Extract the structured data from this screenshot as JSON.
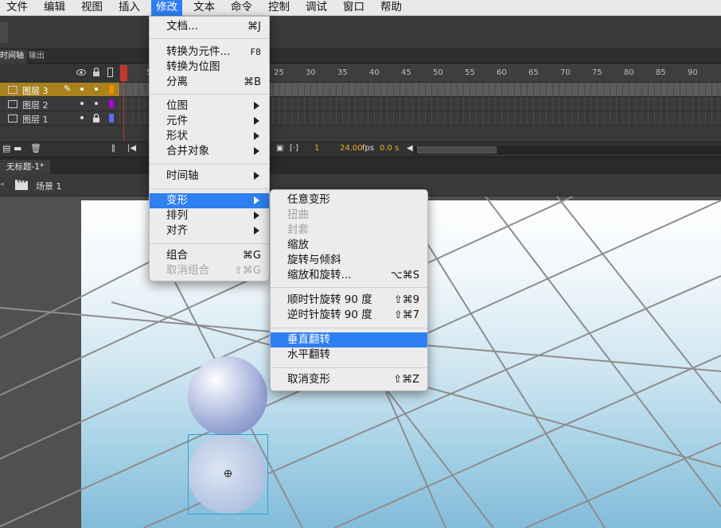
{
  "menubar": [
    "文件",
    "编辑",
    "视图",
    "插入",
    "修改",
    "文本",
    "命令",
    "控制",
    "调试",
    "窗口",
    "帮助"
  ],
  "modify_menu": {
    "items": [
      {
        "label": "文档...",
        "shortcut": "⌘J"
      },
      {
        "label": "转换为元件...",
        "shortcut": "F8"
      },
      {
        "label": "转换为位图",
        "shortcut": ""
      },
      {
        "label": "分离",
        "shortcut": "⌘B"
      },
      {
        "label": "位图",
        "submenu": true
      },
      {
        "label": "元件",
        "submenu": true
      },
      {
        "label": "形状",
        "submenu": true
      },
      {
        "label": "合并对象",
        "submenu": true
      },
      {
        "label": "时间轴",
        "submenu": true
      },
      {
        "label": "变形",
        "submenu": true,
        "highlighted": true
      },
      {
        "label": "排列",
        "submenu": true
      },
      {
        "label": "对齐",
        "submenu": true
      },
      {
        "label": "组合",
        "shortcut": "⌘G"
      },
      {
        "label": "取消组合",
        "shortcut": "⇧⌘G",
        "disabled": true
      }
    ]
  },
  "transform_menu": {
    "items": [
      {
        "label": "任意变形",
        "shortcut": ""
      },
      {
        "label": "扭曲",
        "shortcut": "",
        "disabled": true
      },
      {
        "label": "封套",
        "shortcut": "",
        "disabled": true
      },
      {
        "label": "缩放",
        "shortcut": ""
      },
      {
        "label": "旋转与倾斜",
        "shortcut": ""
      },
      {
        "label": "缩放和旋转...",
        "shortcut": "⌥⌘S"
      },
      {
        "label": "顺时针旋转 90 度",
        "shortcut": "⇧⌘9"
      },
      {
        "label": "逆时针旋转 90 度",
        "shortcut": "⇧⌘7"
      },
      {
        "label": "垂直翻转",
        "shortcut": "",
        "highlighted": true
      },
      {
        "label": "水平翻转",
        "shortcut": ""
      },
      {
        "label": "取消变形",
        "shortcut": "⇧⌘Z"
      }
    ]
  },
  "timeline": {
    "tabs": [
      "时间轴",
      "输出"
    ],
    "ruler_labels": [
      "1",
      "5",
      "25",
      "30",
      "35",
      "40",
      "45",
      "50",
      "55",
      "60",
      "65",
      "70",
      "75",
      "80",
      "85",
      "90"
    ],
    "layers": [
      {
        "name": "图层 3",
        "color": "#f08c00",
        "selected": true
      },
      {
        "name": "图层 2",
        "color": "#b000d0"
      },
      {
        "name": "图层 1",
        "color": "#5a6cf0"
      }
    ],
    "current_frame": "1",
    "fps": "24.00",
    "fps_unit": "fps",
    "time": "0.0 s"
  },
  "document": {
    "tab": "无标题-1*",
    "scene": "场景 1"
  },
  "colors": {
    "accent": "#2e7ff0",
    "selected_layer": "#a9821e",
    "selection_box": "#2aa3d8"
  }
}
